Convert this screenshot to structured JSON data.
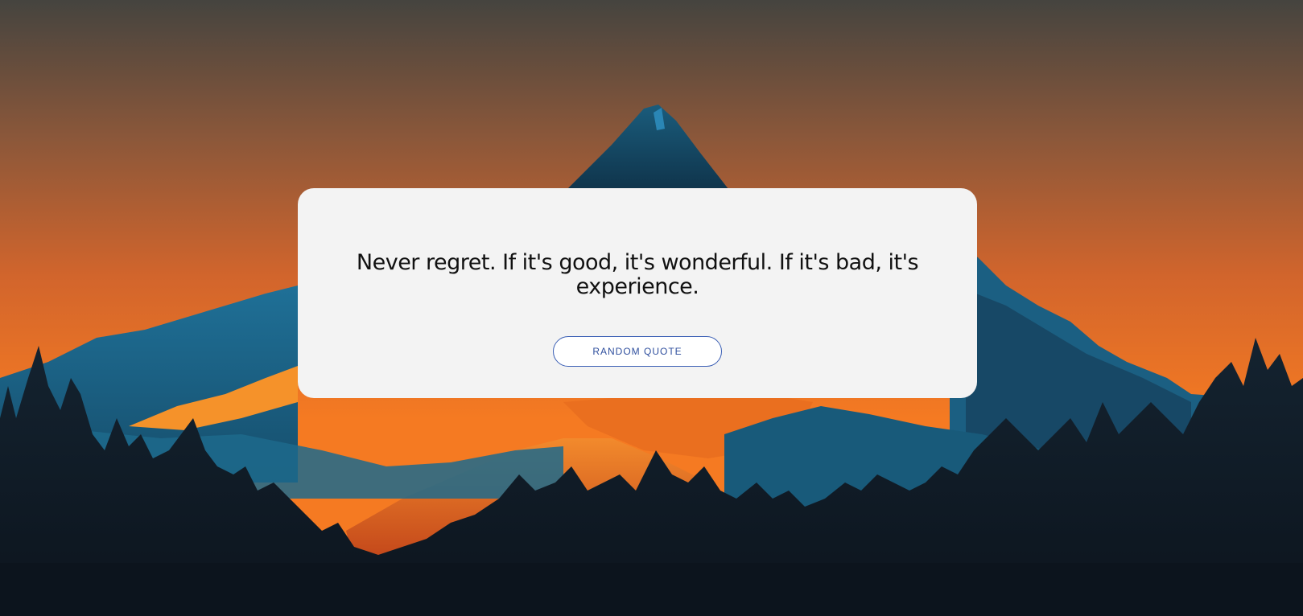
{
  "quote": {
    "text": "Never regret. If it's good, it's wonderful. If it's bad, it's experience."
  },
  "actions": {
    "random_quote_label": "RANDOM QUOTE"
  },
  "colors": {
    "sky_top": "#4a4540",
    "sky_mid": "#b9602f",
    "sky_low": "#f47a22",
    "mountain_blue": "#1d6a8c",
    "mountain_dark": "#0f2235",
    "mountain_orange": "#e86a1c",
    "forest": "#0e1722",
    "card_bg": "#f3f3f3",
    "button_border": "#3b5fb5"
  }
}
